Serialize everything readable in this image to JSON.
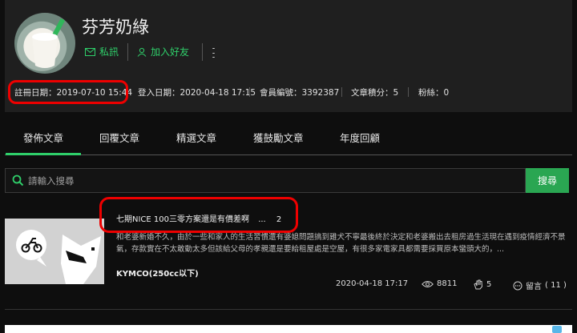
{
  "profile": {
    "name": "芬芳奶綠",
    "message_label": "私訊",
    "add_friend_label": "加入好友",
    "stats": {
      "register": "註冊日期：2019-07-10 15:44",
      "login": "登入日期：2020-04-18 17:15",
      "member_id": "會員編號：3392387",
      "points": "文章積分：5",
      "fans": "粉絲：0"
    }
  },
  "tabs": [
    "發佈文章",
    "回覆文章",
    "精選文章",
    "獲鼓勵文章",
    "年度回顧"
  ],
  "search": {
    "placeholder": "請輸入搜尋",
    "button_label": "搜尋"
  },
  "article": {
    "title": "七期NICE 100三零方案還是有價差啊",
    "ellipsis": "...",
    "page_count": "2",
    "excerpt": "和老婆新婚不久，由於一些和家人的生活習慣還有婆媳問題搞到雞犬不寧最後終於決定和老婆搬出去租房過生活現在遇到疫情經濟不景氣，存款實在不太敢動太多但該給父母的孝親還是要給租屋處是空屋，有很多家電家具都需要採買原本蠻頭大的，...",
    "category": "KYMCO(250cc以下)",
    "date": "2020-04-18 17:17",
    "views": "8811",
    "gp": "5",
    "reply_label": "留言",
    "reply_count": "( 11 )"
  },
  "colors": {
    "accent": "#2fcf6a",
    "button": "#2aa652",
    "highlight": "#e00000"
  }
}
